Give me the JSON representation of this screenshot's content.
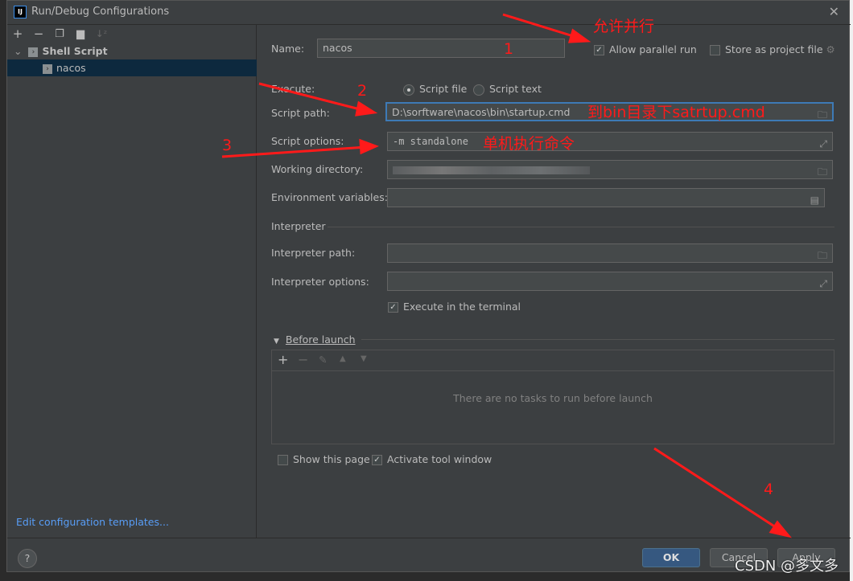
{
  "window": {
    "title": "Run/Debug Configurations",
    "logo": "IJ"
  },
  "toolbar": {
    "icons": [
      "plus-icon",
      "minus-icon",
      "copy-icon",
      "new-folder-icon",
      "sort-icon"
    ]
  },
  "tree": {
    "group": "Shell Script",
    "item": "nacos"
  },
  "left_link": "Edit configuration templates...",
  "form": {
    "name_label": "Name:",
    "name_value": "nacos",
    "allow_parallel": "Allow parallel run",
    "allow_parallel_checked": true,
    "store_project": "Store as project file",
    "store_project_checked": false,
    "execute_label": "Execute:",
    "script_file": "Script file",
    "script_text": "Script text",
    "execute_selected": "Script file",
    "script_path_label": "Script path:",
    "script_path_value": "D:\\sorftware\\nacos\\bin\\startup.cmd",
    "script_options_label": "Script options:",
    "script_options_value": "-m standalone",
    "working_dir_label": "Working directory:",
    "env_label": "Environment variables:",
    "interpreter_section": "Interpreter",
    "interp_path_label": "Interpreter path:",
    "interp_options_label": "Interpreter options:",
    "exec_terminal": "Execute in the terminal",
    "exec_terminal_checked": true,
    "before_launch": "Before launch",
    "no_tasks": "There are no tasks to run before launch",
    "show_page": "Show this page",
    "show_page_checked": false,
    "activate_tool": "Activate tool window",
    "activate_tool_checked": true
  },
  "buttons": {
    "ok": "OK",
    "cancel": "Cancel",
    "apply": "Apply",
    "help": "?"
  },
  "annotations": {
    "a1_text": "允许并行",
    "a1_num": "1",
    "a2_num": "2",
    "a2_text": "到bin目录下satrtup.cmd",
    "a3_num": "3",
    "a3_text": "单机执行命令",
    "a4_num": "4",
    "color": "#ff1a1a"
  },
  "watermark": "CSDN @多文多"
}
